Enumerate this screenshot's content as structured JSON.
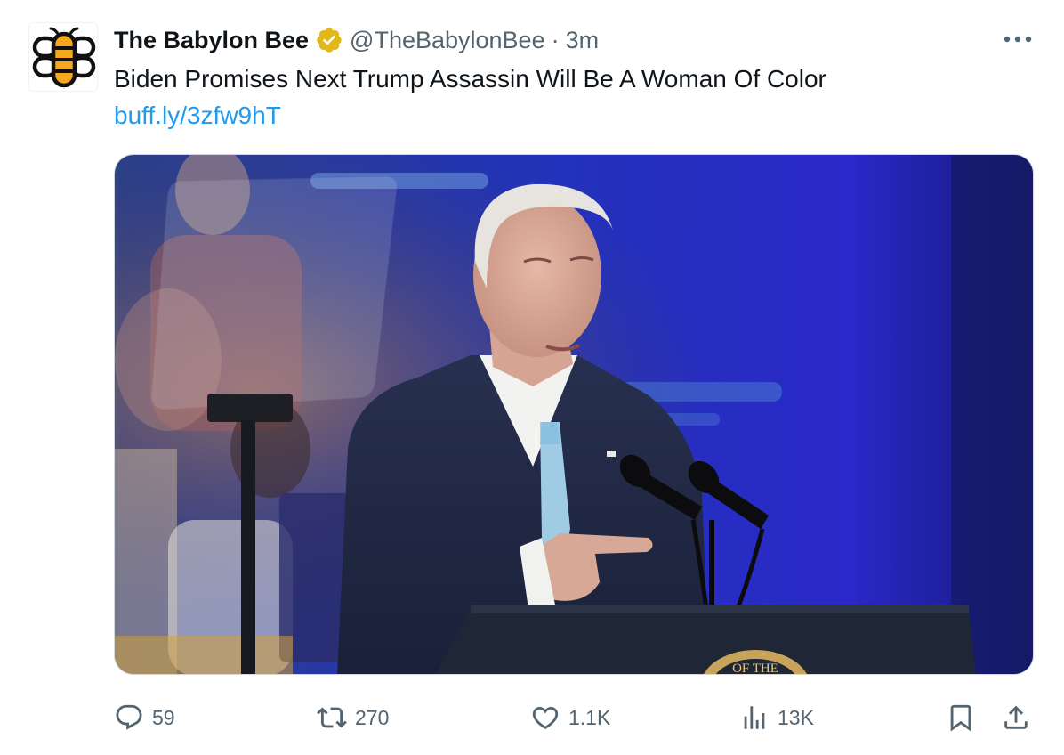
{
  "tweet": {
    "author": {
      "display_name": "The Babylon Bee",
      "handle": "@TheBabylonBee",
      "verified": true,
      "avatar_icon": "bee-logo-icon"
    },
    "separator": "·",
    "time": "3m",
    "text": "Biden Promises Next Trump Assassin Will Be A Woman Of Color",
    "link": "buff.ly/3zfw9hT",
    "media": {
      "type": "photo",
      "visible_text": "OF THE"
    },
    "actions": {
      "replies": "59",
      "reposts": "270",
      "likes": "1.1K",
      "views": "13K"
    }
  },
  "colors": {
    "text": "#0f1419",
    "secondary": "#536471",
    "link": "#1d9bf0",
    "verified_gold": "#e2b719",
    "bee_gold": "#f4a81d"
  }
}
